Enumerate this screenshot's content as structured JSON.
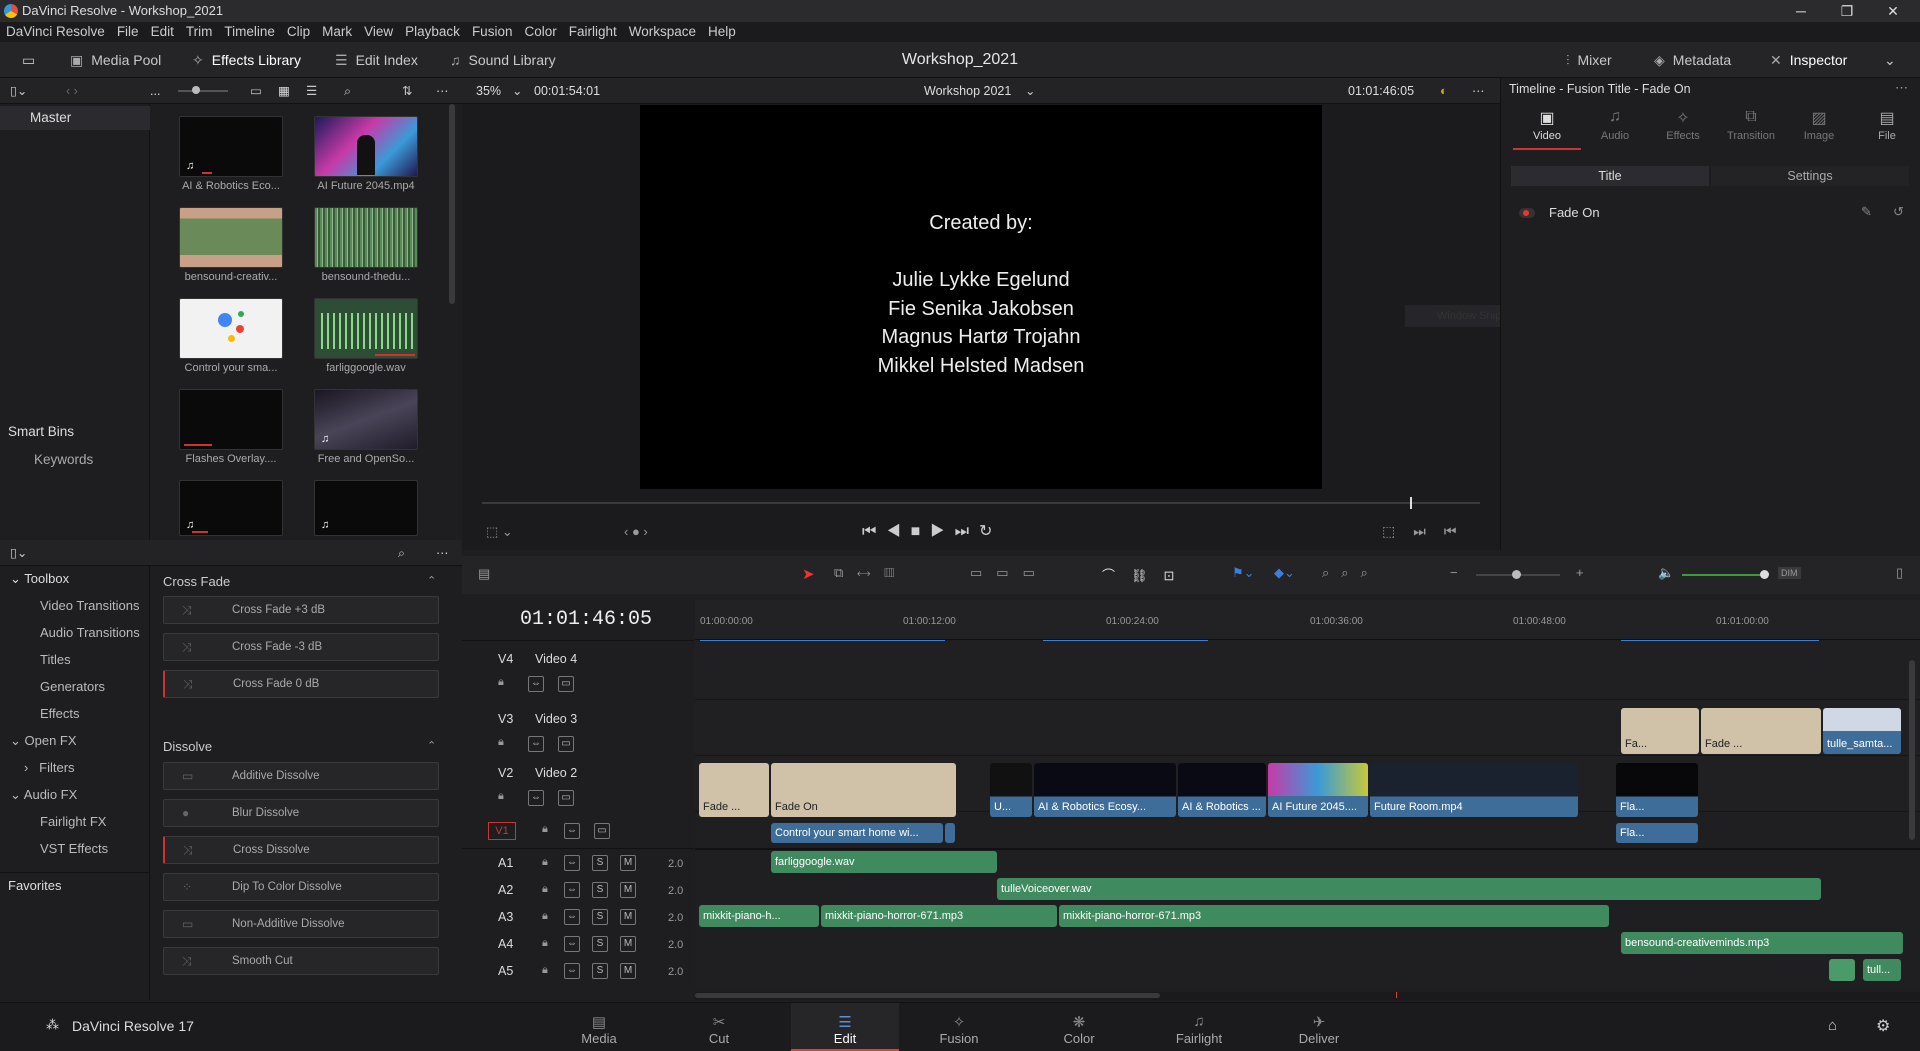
{
  "window": {
    "title": "DaVinci Resolve - Workshop_2021",
    "minimize": "─",
    "maximize": "❐",
    "close": "✕"
  },
  "menu": [
    "DaVinci Resolve",
    "File",
    "Edit",
    "Trim",
    "Timeline",
    "Clip",
    "Mark",
    "View",
    "Playback",
    "Fusion",
    "Color",
    "Fairlight",
    "Workspace",
    "Help"
  ],
  "toolbar": {
    "media_pool": "Media Pool",
    "effects_library": "Effects Library",
    "edit_index": "Edit Index",
    "sound_library": "Sound Library",
    "project_title": "Workshop_2021",
    "mixer": "Mixer",
    "metadata": "Metadata",
    "inspector": "Inspector"
  },
  "subbar": {
    "ellipsis": "...",
    "zoom": "35%",
    "source_tc": "00:01:54:01",
    "timeline_name": "Workshop 2021",
    "record_tc": "01:01:46:05"
  },
  "bins": {
    "master": "Master",
    "smart_bins": "Smart Bins",
    "keywords": "Keywords"
  },
  "media": [
    {
      "label": "AI & Robotics Eco..."
    },
    {
      "label": "AI Future 2045.mp4"
    },
    {
      "label": "bensound-creativ..."
    },
    {
      "label": "bensound-thedu..."
    },
    {
      "label": "Control your sma..."
    },
    {
      "label": "farliggoogle.wav"
    },
    {
      "label": "Flashes Overlay...."
    },
    {
      "label": "Free and OpenSo..."
    }
  ],
  "toolbox": {
    "items": [
      "Toolbox",
      "Video Transitions",
      "Audio Transitions",
      "Titles",
      "Generators",
      "Effects",
      "Open FX",
      "Filters",
      "Audio FX",
      "Fairlight FX",
      "VST Effects",
      "Favorites"
    ]
  },
  "effects": {
    "cross_fade_head": "Cross Fade",
    "cross_fade": [
      "Cross Fade +3 dB",
      "Cross Fade -3 dB",
      "Cross Fade 0 dB"
    ],
    "dissolve_head": "Dissolve",
    "dissolve": [
      "Additive Dissolve",
      "Blur Dissolve",
      "Cross Dissolve",
      "Dip To Color Dissolve",
      "Non-Additive Dissolve",
      "Smooth Cut"
    ]
  },
  "viewer": {
    "lines": [
      "Created by:",
      "",
      "Julie Lykke Egelund",
      "Fie Senika Jakobsen",
      "Magnus Hartø Trojahn",
      "Mikkel Helsted Madsen"
    ],
    "ghost": "Window Snip"
  },
  "inspector": {
    "header": "Timeline - Fusion Title - Fade On",
    "tabs": [
      "Video",
      "Audio",
      "Effects",
      "Transition",
      "Image",
      "File"
    ],
    "sub_tabs": [
      "Title",
      "Settings"
    ],
    "effect_name": "Fade On"
  },
  "timeline": {
    "timecode": "01:01:46:05",
    "ruler": [
      "01:00:00:00",
      "01:00:12:00",
      "01:00:24:00",
      "01:00:36:00",
      "01:00:48:00",
      "01:01:00:00"
    ],
    "tracks": [
      {
        "id": "V4",
        "name": "Video 4"
      },
      {
        "id": "V3",
        "name": "Video 3"
      },
      {
        "id": "V2",
        "name": "Video 2"
      },
      {
        "id": "V1",
        "name": ""
      },
      {
        "id": "A1",
        "vol": "2.0"
      },
      {
        "id": "A2",
        "vol": "2.0"
      },
      {
        "id": "A3",
        "vol": "2.0"
      },
      {
        "id": "A4",
        "vol": "2.0"
      },
      {
        "id": "A5",
        "vol": "2.0"
      }
    ],
    "clips": {
      "v3_a": "Fa...",
      "v3_b": "Fade ...",
      "v3_c": "tulle_samta...",
      "v2_a": "Fade ...",
      "v2_b": "Fade On",
      "v2_c": "U...",
      "v2_d": "AI & Robotics Ecosy...",
      "v2_e": "AI & Robotics ...",
      "v2_f": "AI Future 2045....",
      "v2_g": "Future Room.mp4",
      "v2_h": "Fla...",
      "v1_a": "Control your smart home wi...",
      "v1_b": "Fla...",
      "a1": "farliggoogle.wav",
      "a2": "tulleVoiceover.wav",
      "a3_a": "mixkit-piano-h...",
      "a3_b": "mixkit-piano-horror-671.mp3",
      "a3_c": "mixkit-piano-horror-671.mp3",
      "a4": "bensound-creativeminds.mp3",
      "a5": "tull..."
    },
    "dim": "DIM",
    "s": "S",
    "m": "M"
  },
  "pages": [
    "Media",
    "Cut",
    "Edit",
    "Fusion",
    "Color",
    "Fairlight",
    "Deliver"
  ],
  "app_name": "DaVinci Resolve 17"
}
